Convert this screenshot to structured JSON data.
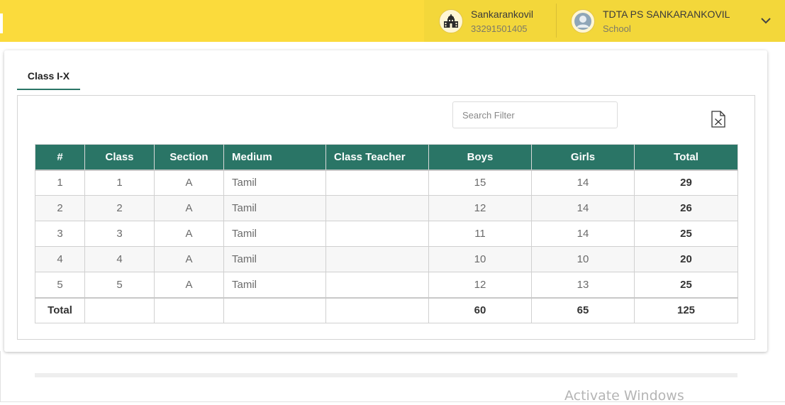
{
  "header": {
    "school": {
      "name": "Sankarankovil",
      "code": "33291501405",
      "icon": "school-building-icon"
    },
    "user": {
      "name": "TDTA PS SANKARANKOVIL",
      "role": "School",
      "icon": "user-avatar-icon"
    },
    "menu_icon": "chevron-down-icon",
    "accent": "#fbdb3c"
  },
  "tabs": [
    {
      "label": "Class I-X"
    }
  ],
  "toolbar": {
    "search_placeholder": "Search Filter",
    "export_icon": "excel-export-icon"
  },
  "table": {
    "header_color": "#2a7566",
    "columns": [
      "#",
      "Class",
      "Section",
      "Medium",
      "Class Teacher",
      "Boys",
      "Girls",
      "Total"
    ],
    "rows": [
      {
        "no": "1",
        "class": "1",
        "section": "A",
        "medium": "Tamil",
        "teacher": "",
        "boys": "15",
        "girls": "14",
        "total": "29"
      },
      {
        "no": "2",
        "class": "2",
        "section": "A",
        "medium": "Tamil",
        "teacher": "",
        "boys": "12",
        "girls": "14",
        "total": "26"
      },
      {
        "no": "3",
        "class": "3",
        "section": "A",
        "medium": "Tamil",
        "teacher": "",
        "boys": "11",
        "girls": "14",
        "total": "25"
      },
      {
        "no": "4",
        "class": "4",
        "section": "A",
        "medium": "Tamil",
        "teacher": "",
        "boys": "10",
        "girls": "10",
        "total": "20"
      },
      {
        "no": "5",
        "class": "5",
        "section": "A",
        "medium": "Tamil",
        "teacher": "",
        "boys": "12",
        "girls": "13",
        "total": "25"
      }
    ],
    "totals": {
      "label": "Total",
      "boys": "60",
      "girls": "65",
      "total": "125"
    }
  },
  "watermark": "Activate Windows"
}
